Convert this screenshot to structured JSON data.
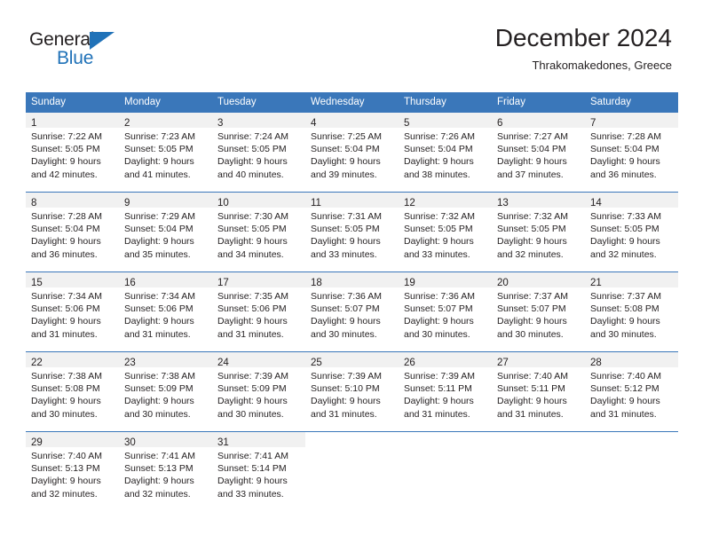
{
  "brand": {
    "name_top": "General",
    "name_bottom": "Blue",
    "accent_color": "#2072b8"
  },
  "header": {
    "title": "December 2024",
    "subtitle": "Thrakomakedones, Greece"
  },
  "theme": {
    "header_row_bg": "#3a77ba",
    "header_row_text": "#ffffff",
    "daynum_band_bg": "#f1f1f1",
    "text_color": "#231f20",
    "grid_line": "#3a77ba"
  },
  "weekday_headers": [
    "Sunday",
    "Monday",
    "Tuesday",
    "Wednesday",
    "Thursday",
    "Friday",
    "Saturday"
  ],
  "weeks": [
    [
      {
        "day": "1",
        "sunrise": "Sunrise: 7:22 AM",
        "sunset": "Sunset: 5:05 PM",
        "daylight_1": "Daylight: 9 hours",
        "daylight_2": "and 42 minutes."
      },
      {
        "day": "2",
        "sunrise": "Sunrise: 7:23 AM",
        "sunset": "Sunset: 5:05 PM",
        "daylight_1": "Daylight: 9 hours",
        "daylight_2": "and 41 minutes."
      },
      {
        "day": "3",
        "sunrise": "Sunrise: 7:24 AM",
        "sunset": "Sunset: 5:05 PM",
        "daylight_1": "Daylight: 9 hours",
        "daylight_2": "and 40 minutes."
      },
      {
        "day": "4",
        "sunrise": "Sunrise: 7:25 AM",
        "sunset": "Sunset: 5:04 PM",
        "daylight_1": "Daylight: 9 hours",
        "daylight_2": "and 39 minutes."
      },
      {
        "day": "5",
        "sunrise": "Sunrise: 7:26 AM",
        "sunset": "Sunset: 5:04 PM",
        "daylight_1": "Daylight: 9 hours",
        "daylight_2": "and 38 minutes."
      },
      {
        "day": "6",
        "sunrise": "Sunrise: 7:27 AM",
        "sunset": "Sunset: 5:04 PM",
        "daylight_1": "Daylight: 9 hours",
        "daylight_2": "and 37 minutes."
      },
      {
        "day": "7",
        "sunrise": "Sunrise: 7:28 AM",
        "sunset": "Sunset: 5:04 PM",
        "daylight_1": "Daylight: 9 hours",
        "daylight_2": "and 36 minutes."
      }
    ],
    [
      {
        "day": "8",
        "sunrise": "Sunrise: 7:28 AM",
        "sunset": "Sunset: 5:04 PM",
        "daylight_1": "Daylight: 9 hours",
        "daylight_2": "and 36 minutes."
      },
      {
        "day": "9",
        "sunrise": "Sunrise: 7:29 AM",
        "sunset": "Sunset: 5:04 PM",
        "daylight_1": "Daylight: 9 hours",
        "daylight_2": "and 35 minutes."
      },
      {
        "day": "10",
        "sunrise": "Sunrise: 7:30 AM",
        "sunset": "Sunset: 5:05 PM",
        "daylight_1": "Daylight: 9 hours",
        "daylight_2": "and 34 minutes."
      },
      {
        "day": "11",
        "sunrise": "Sunrise: 7:31 AM",
        "sunset": "Sunset: 5:05 PM",
        "daylight_1": "Daylight: 9 hours",
        "daylight_2": "and 33 minutes."
      },
      {
        "day": "12",
        "sunrise": "Sunrise: 7:32 AM",
        "sunset": "Sunset: 5:05 PM",
        "daylight_1": "Daylight: 9 hours",
        "daylight_2": "and 33 minutes."
      },
      {
        "day": "13",
        "sunrise": "Sunrise: 7:32 AM",
        "sunset": "Sunset: 5:05 PM",
        "daylight_1": "Daylight: 9 hours",
        "daylight_2": "and 32 minutes."
      },
      {
        "day": "14",
        "sunrise": "Sunrise: 7:33 AM",
        "sunset": "Sunset: 5:05 PM",
        "daylight_1": "Daylight: 9 hours",
        "daylight_2": "and 32 minutes."
      }
    ],
    [
      {
        "day": "15",
        "sunrise": "Sunrise: 7:34 AM",
        "sunset": "Sunset: 5:06 PM",
        "daylight_1": "Daylight: 9 hours",
        "daylight_2": "and 31 minutes."
      },
      {
        "day": "16",
        "sunrise": "Sunrise: 7:34 AM",
        "sunset": "Sunset: 5:06 PM",
        "daylight_1": "Daylight: 9 hours",
        "daylight_2": "and 31 minutes."
      },
      {
        "day": "17",
        "sunrise": "Sunrise: 7:35 AM",
        "sunset": "Sunset: 5:06 PM",
        "daylight_1": "Daylight: 9 hours",
        "daylight_2": "and 31 minutes."
      },
      {
        "day": "18",
        "sunrise": "Sunrise: 7:36 AM",
        "sunset": "Sunset: 5:07 PM",
        "daylight_1": "Daylight: 9 hours",
        "daylight_2": "and 30 minutes."
      },
      {
        "day": "19",
        "sunrise": "Sunrise: 7:36 AM",
        "sunset": "Sunset: 5:07 PM",
        "daylight_1": "Daylight: 9 hours",
        "daylight_2": "and 30 minutes."
      },
      {
        "day": "20",
        "sunrise": "Sunrise: 7:37 AM",
        "sunset": "Sunset: 5:07 PM",
        "daylight_1": "Daylight: 9 hours",
        "daylight_2": "and 30 minutes."
      },
      {
        "day": "21",
        "sunrise": "Sunrise: 7:37 AM",
        "sunset": "Sunset: 5:08 PM",
        "daylight_1": "Daylight: 9 hours",
        "daylight_2": "and 30 minutes."
      }
    ],
    [
      {
        "day": "22",
        "sunrise": "Sunrise: 7:38 AM",
        "sunset": "Sunset: 5:08 PM",
        "daylight_1": "Daylight: 9 hours",
        "daylight_2": "and 30 minutes."
      },
      {
        "day": "23",
        "sunrise": "Sunrise: 7:38 AM",
        "sunset": "Sunset: 5:09 PM",
        "daylight_1": "Daylight: 9 hours",
        "daylight_2": "and 30 minutes."
      },
      {
        "day": "24",
        "sunrise": "Sunrise: 7:39 AM",
        "sunset": "Sunset: 5:09 PM",
        "daylight_1": "Daylight: 9 hours",
        "daylight_2": "and 30 minutes."
      },
      {
        "day": "25",
        "sunrise": "Sunrise: 7:39 AM",
        "sunset": "Sunset: 5:10 PM",
        "daylight_1": "Daylight: 9 hours",
        "daylight_2": "and 31 minutes."
      },
      {
        "day": "26",
        "sunrise": "Sunrise: 7:39 AM",
        "sunset": "Sunset: 5:11 PM",
        "daylight_1": "Daylight: 9 hours",
        "daylight_2": "and 31 minutes."
      },
      {
        "day": "27",
        "sunrise": "Sunrise: 7:40 AM",
        "sunset": "Sunset: 5:11 PM",
        "daylight_1": "Daylight: 9 hours",
        "daylight_2": "and 31 minutes."
      },
      {
        "day": "28",
        "sunrise": "Sunrise: 7:40 AM",
        "sunset": "Sunset: 5:12 PM",
        "daylight_1": "Daylight: 9 hours",
        "daylight_2": "and 31 minutes."
      }
    ],
    [
      {
        "day": "29",
        "sunrise": "Sunrise: 7:40 AM",
        "sunset": "Sunset: 5:13 PM",
        "daylight_1": "Daylight: 9 hours",
        "daylight_2": "and 32 minutes."
      },
      {
        "day": "30",
        "sunrise": "Sunrise: 7:41 AM",
        "sunset": "Sunset: 5:13 PM",
        "daylight_1": "Daylight: 9 hours",
        "daylight_2": "and 32 minutes."
      },
      {
        "day": "31",
        "sunrise": "Sunrise: 7:41 AM",
        "sunset": "Sunset: 5:14 PM",
        "daylight_1": "Daylight: 9 hours",
        "daylight_2": "and 33 minutes."
      },
      {
        "day": "",
        "sunrise": "",
        "sunset": "",
        "daylight_1": "",
        "daylight_2": ""
      },
      {
        "day": "",
        "sunrise": "",
        "sunset": "",
        "daylight_1": "",
        "daylight_2": ""
      },
      {
        "day": "",
        "sunrise": "",
        "sunset": "",
        "daylight_1": "",
        "daylight_2": ""
      },
      {
        "day": "",
        "sunrise": "",
        "sunset": "",
        "daylight_1": "",
        "daylight_2": ""
      }
    ]
  ]
}
